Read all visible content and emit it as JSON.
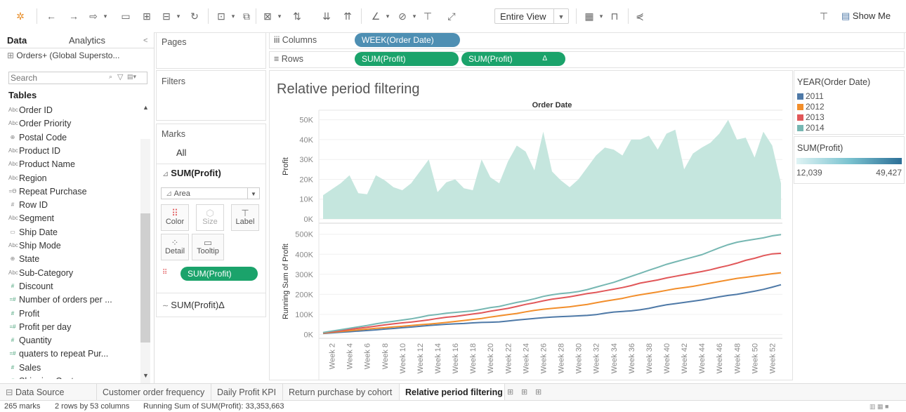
{
  "toolbar": {
    "entire_view": "Entire View",
    "show_me": "Show Me",
    "icons": [
      "tableau-logo-icon",
      "undo-icon",
      "redo-icon",
      "replay-icon",
      "save-icon",
      "new-datasource-icon",
      "new-worksheet-icon",
      "refresh-icon",
      "pause-icon",
      "swap-icon",
      "clear-sheet-icon",
      "sort-asc-icon",
      "sort-desc-icon",
      "group-icon",
      "highlight-icon",
      "labels-icon",
      "fix-axes-icon",
      "fit-icon",
      "show-cards-icon",
      "presentation-icon",
      "share-icon",
      "tooltip-icon",
      "show-me-icon"
    ]
  },
  "data_pane": {
    "tab_data": "Data",
    "tab_analytics": "Analytics",
    "collapse_glyph": "<",
    "datasource": "Orders+ (Global Supersto...",
    "search_placeholder": "Search",
    "tables_heading": "Tables",
    "fields": [
      {
        "icon": "Abc",
        "name": "Order ID",
        "kind": "dim"
      },
      {
        "icon": "Abc",
        "name": "Order Priority",
        "kind": "dim"
      },
      {
        "icon": "⊕",
        "name": "Postal Code",
        "kind": "dim"
      },
      {
        "icon": "Abc",
        "name": "Product ID",
        "kind": "dim"
      },
      {
        "icon": "Abc",
        "name": "Product Name",
        "kind": "dim"
      },
      {
        "icon": "Abc",
        "name": "Region",
        "kind": "dim"
      },
      {
        "icon": "=Ө",
        "name": "Repeat Purchase",
        "kind": "dim"
      },
      {
        "icon": "#",
        "name": "Row ID",
        "kind": "dim"
      },
      {
        "icon": "Abc",
        "name": "Segment",
        "kind": "dim"
      },
      {
        "icon": "▭",
        "name": "Ship Date",
        "kind": "dim"
      },
      {
        "icon": "Abc",
        "name": "Ship Mode",
        "kind": "dim"
      },
      {
        "icon": "⊕",
        "name": "State",
        "kind": "dim"
      },
      {
        "icon": "Abc",
        "name": "Sub-Category",
        "kind": "dim"
      },
      {
        "icon": "#",
        "name": "Discount",
        "kind": "meas"
      },
      {
        "icon": "=#",
        "name": "Number of orders per ...",
        "kind": "meas"
      },
      {
        "icon": "#",
        "name": "Profit",
        "kind": "meas"
      },
      {
        "icon": "=#",
        "name": "Profit per day",
        "kind": "meas"
      },
      {
        "icon": "#",
        "name": "Quantity",
        "kind": "meas"
      },
      {
        "icon": "=#",
        "name": "quaters to repeat Pur...",
        "kind": "meas"
      },
      {
        "icon": "#",
        "name": "Sales",
        "kind": "meas"
      },
      {
        "icon": "#",
        "name": "Shipping Cost",
        "kind": "meas"
      }
    ]
  },
  "shelves": {
    "pages_label": "Pages",
    "filters_label": "Filters",
    "columns_label": "iii Columns",
    "rows_label": "≡ Rows",
    "columns_pill": "WEEK(Order Date)",
    "rows_pill_1": "SUM(Profit)",
    "rows_pill_2": "SUM(Profit)",
    "rows_pill_2_flag": "Δ"
  },
  "marks": {
    "title": "Marks",
    "all_label": "All",
    "card1_title": "SUM(Profit)",
    "mark_type": "Area",
    "buttons": {
      "color": "Color",
      "size": "Size",
      "label": "Label",
      "detail": "Detail",
      "tooltip": "Tooltip"
    },
    "color_pill": "SUM(Profit)",
    "card2_title": "SUM(Profit)Δ"
  },
  "legend": {
    "year_title": "YEAR(Order Date)",
    "years": [
      {
        "label": "2011",
        "color": "#4e79a7"
      },
      {
        "label": "2012",
        "color": "#f28e2b"
      },
      {
        "label": "2013",
        "color": "#e15759"
      },
      {
        "label": "2014",
        "color": "#76b7b2"
      }
    ],
    "profit_title": "SUM(Profit)",
    "min_label": "12,039",
    "max_label": "49,427"
  },
  "chart_data": {
    "type": "area",
    "title": "Relative period filtering",
    "header": "Order Date",
    "x_ticks": [
      "Week 2",
      "Week 4",
      "Week 6",
      "Week 8",
      "Week 10",
      "Week 12",
      "Week 14",
      "Week 16",
      "Week 18",
      "Week 20",
      "Week 22",
      "Week 24",
      "Week 26",
      "Week 28",
      "Week 30",
      "Week 32",
      "Week 34",
      "Week 36",
      "Week 38",
      "Week 40",
      "Week 42",
      "Week 44",
      "Week 46",
      "Week 48",
      "Week 50",
      "Week 52"
    ],
    "top": {
      "ylabel": "Profit",
      "yticks": [
        "0K",
        "10K",
        "20K",
        "30K",
        "40K",
        "50K"
      ],
      "ylim": [
        0,
        52000
      ],
      "color": "#c5e6de",
      "weeks": [
        1,
        2,
        3,
        4,
        5,
        6,
        7,
        8,
        9,
        10,
        11,
        12,
        13,
        14,
        15,
        16,
        17,
        18,
        19,
        20,
        21,
        22,
        23,
        24,
        25,
        26,
        27,
        28,
        29,
        30,
        31,
        32,
        33,
        34,
        35,
        36,
        37,
        38,
        39,
        40,
        41,
        42,
        43,
        44,
        45,
        46,
        47,
        48,
        49,
        50,
        51,
        52,
        53
      ],
      "values": [
        12000,
        15000,
        18000,
        22000,
        13000,
        12500,
        22000,
        19500,
        16000,
        14500,
        18000,
        24000,
        30000,
        13500,
        18500,
        20000,
        15500,
        14500,
        30000,
        21000,
        18000,
        29000,
        37000,
        34000,
        24500,
        44000,
        24000,
        19500,
        16000,
        20000,
        26000,
        32000,
        36000,
        35000,
        32000,
        40000,
        40000,
        42000,
        35000,
        43000,
        45000,
        25000,
        33000,
        36000,
        38500,
        43000,
        50000,
        40000,
        41000,
        31000,
        44000,
        37000,
        18000
      ]
    },
    "bottom": {
      "ylabel": "Running Sum of Profit",
      "yticks": [
        "0K",
        "100K",
        "200K",
        "300K",
        "400K",
        "500K"
      ],
      "ylim": [
        -5000,
        520000
      ],
      "series": [
        {
          "name": "2011",
          "color": "#4e79a7",
          "values": [
            5000,
            8000,
            11000,
            14000,
            17000,
            20000,
            23000,
            27000,
            30000,
            34000,
            37000,
            41000,
            45000,
            48000,
            51000,
            53000,
            55000,
            58000,
            60000,
            61000,
            63000,
            67000,
            72000,
            76000,
            80000,
            84000,
            87000,
            89000,
            91000,
            93000,
            95000,
            99000,
            106000,
            112000,
            115000,
            118000,
            123000,
            130000,
            140000,
            148000,
            154000,
            160000,
            166000,
            172000,
            180000,
            188000,
            195000,
            200000,
            208000,
            216000,
            225000,
            236000,
            248000
          ]
        },
        {
          "name": "2012",
          "color": "#f28e2b",
          "values": [
            7000,
            11000,
            15000,
            19000,
            23000,
            27000,
            31000,
            34000,
            38000,
            41000,
            45000,
            49000,
            52000,
            56000,
            60000,
            65000,
            70000,
            75000,
            80000,
            87000,
            93000,
            99000,
            105000,
            113000,
            120000,
            126000,
            130000,
            134000,
            138000,
            144000,
            150000,
            158000,
            166000,
            173000,
            180000,
            190000,
            198000,
            205000,
            212000,
            220000,
            228000,
            234000,
            240000,
            248000,
            256000,
            264000,
            272000,
            280000,
            285000,
            291000,
            297000,
            303000,
            308000
          ]
        },
        {
          "name": "2013",
          "color": "#e15759",
          "values": [
            9000,
            14000,
            19000,
            25000,
            31000,
            36000,
            42000,
            48000,
            53000,
            58000,
            62000,
            67000,
            73000,
            80000,
            86000,
            90000,
            96000,
            102000,
            108000,
            116000,
            123000,
            130000,
            140000,
            150000,
            158000,
            168000,
            176000,
            182000,
            188000,
            196000,
            204000,
            210000,
            218000,
            226000,
            234000,
            244000,
            256000,
            264000,
            272000,
            282000,
            290000,
            298000,
            306000,
            314000,
            323000,
            334000,
            344000,
            356000,
            370000,
            380000,
            393000,
            402000,
            405000
          ]
        },
        {
          "name": "2014",
          "color": "#76b7b2",
          "values": [
            10000,
            17000,
            24000,
            31000,
            38000,
            45000,
            53000,
            60000,
            66000,
            72000,
            78000,
            86000,
            95000,
            100000,
            106000,
            110000,
            114000,
            118000,
            126000,
            134000,
            140000,
            150000,
            160000,
            168000,
            178000,
            190000,
            198000,
            204000,
            208000,
            214000,
            224000,
            236000,
            248000,
            260000,
            275000,
            290000,
            305000,
            320000,
            335000,
            350000,
            362000,
            374000,
            386000,
            398000,
            415000,
            432000,
            448000,
            460000,
            468000,
            475000,
            482000,
            492000,
            498000
          ]
        }
      ]
    }
  },
  "sheet_tabs": {
    "data_source": "Data Source",
    "tabs": [
      "Customer order frequency",
      "Daily Profit KPI",
      "Return purchase by cohort",
      "Relative period filtering"
    ],
    "active": "Relative period filtering"
  },
  "status": {
    "marks": "265 marks",
    "dims": "2 rows by 53 columns",
    "sum": "Running Sum of SUM(Profit): 33,353,663"
  }
}
